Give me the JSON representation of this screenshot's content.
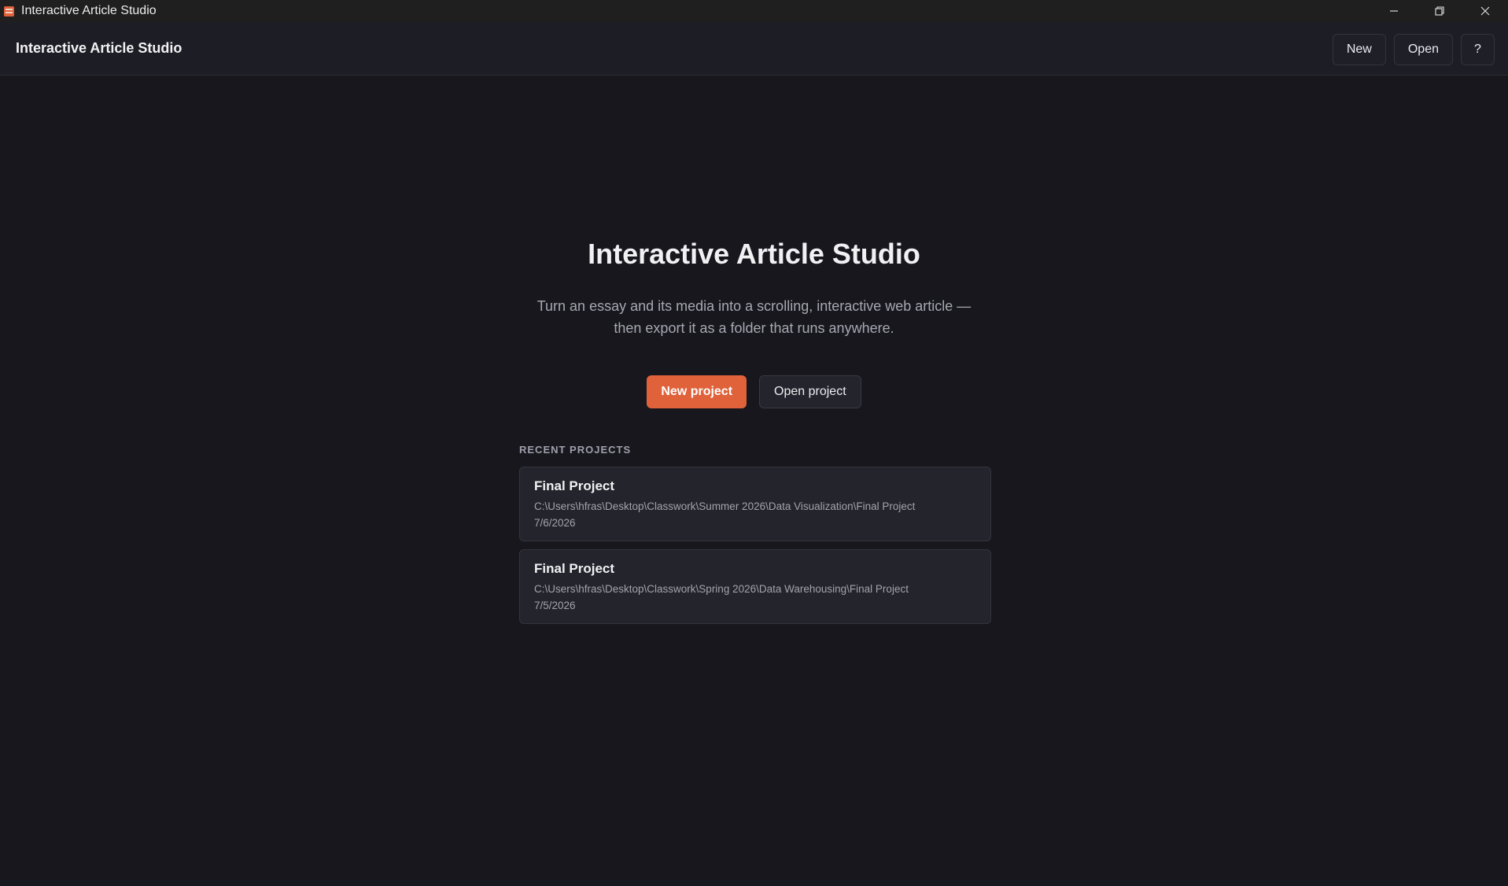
{
  "window": {
    "title": "Interactive Article Studio"
  },
  "header": {
    "title": "Interactive Article Studio",
    "new_label": "New",
    "open_label": "Open",
    "help_label": "?"
  },
  "hero": {
    "title": "Interactive Article Studio",
    "subtitle_line1": "Turn an essay and its media into a scrolling, interactive web article —",
    "subtitle_line2": "then export it as a folder that runs anywhere.",
    "new_project_label": "New project",
    "open_project_label": "Open project"
  },
  "recent": {
    "heading": "RECENT PROJECTS",
    "items": [
      {
        "name": "Final Project",
        "path": "C:\\Users\\hfras\\Desktop\\Classwork\\Summer 2026\\Data Visualization\\Final Project",
        "date": "7/6/2026"
      },
      {
        "name": "Final Project",
        "path": "C:\\Users\\hfras\\Desktop\\Classwork\\Spring 2026\\Data Warehousing\\Final Project",
        "date": "7/5/2026"
      }
    ]
  },
  "colors": {
    "accent": "#e0623a",
    "background": "#17171d",
    "header_bg": "#1d1d25",
    "card_bg": "#24242c"
  },
  "icons": {
    "app": "app-icon",
    "minimize": "minimize-icon",
    "restore": "restore-icon",
    "close": "close-icon"
  }
}
